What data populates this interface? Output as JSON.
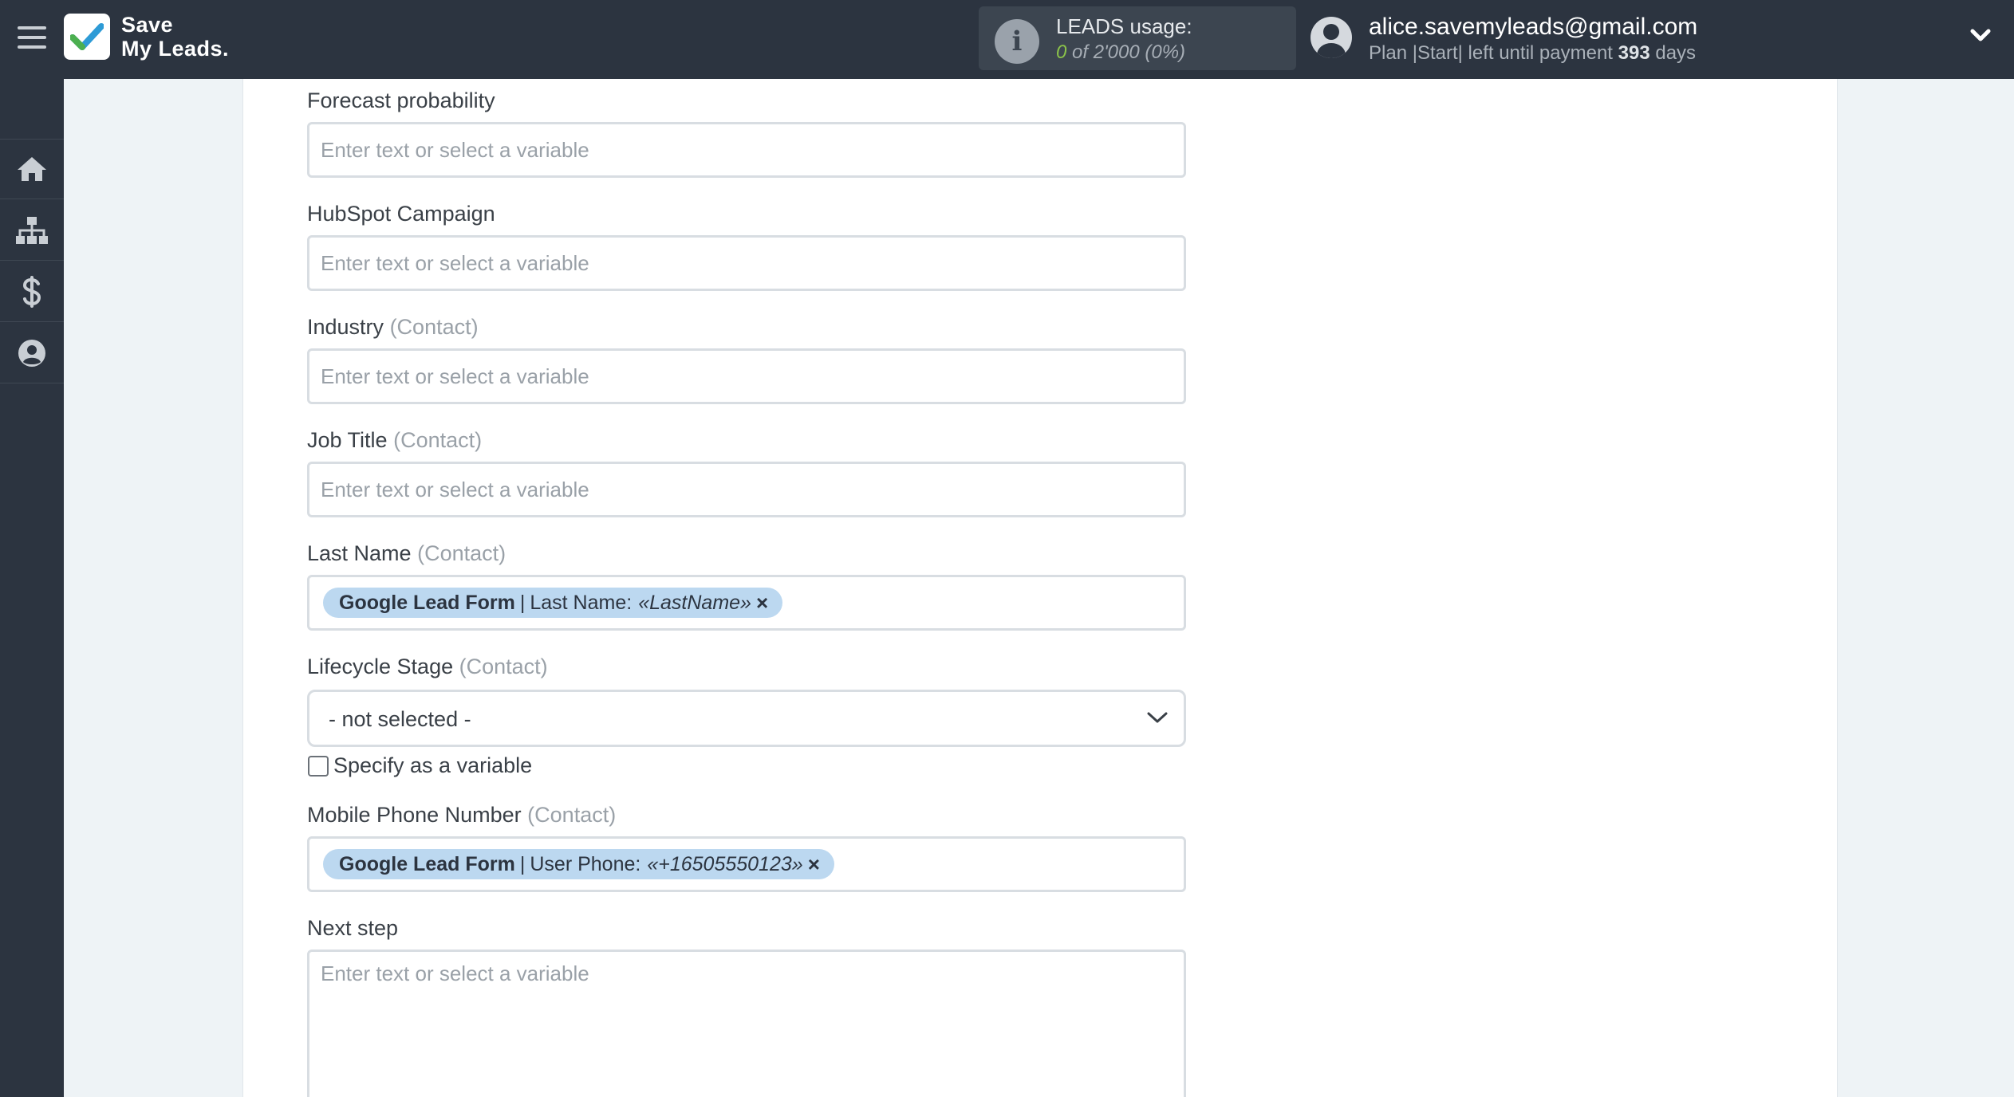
{
  "brand": {
    "line1": "Save",
    "line2": "My Leads."
  },
  "usage": {
    "title": "LEADS usage:",
    "count": "0",
    "of_total": "of 2'000",
    "percent": "(0%)"
  },
  "account": {
    "email": "alice.savemyleads@gmail.com",
    "plan_prefix": "Plan |Start| left until payment",
    "days": "393",
    "days_suffix": "days"
  },
  "sidebar": {
    "items": [
      {
        "icon": "home-icon"
      },
      {
        "icon": "sitemap-icon"
      },
      {
        "icon": "dollar-icon"
      },
      {
        "icon": "user-circle-icon"
      }
    ]
  },
  "form": {
    "placeholder": "Enter text or select a variable",
    "forecast": {
      "label": "Forecast probability"
    },
    "campaign": {
      "label": "HubSpot Campaign"
    },
    "industry": {
      "label": "Industry",
      "hint": "(Contact)"
    },
    "job_title": {
      "label": "Job Title",
      "hint": "(Contact)"
    },
    "last_name": {
      "label": "Last Name",
      "hint": "(Contact)",
      "tag": {
        "source": "Google Lead Form",
        "sep": "|",
        "field": "Last Name:",
        "value": "«LastName»",
        "remove": "×"
      }
    },
    "lifecycle": {
      "label": "Lifecycle Stage",
      "hint": "(Contact)",
      "selected": "- not selected -",
      "checkbox_label": "Specify as a variable"
    },
    "mobile": {
      "label": "Mobile Phone Number",
      "hint": "(Contact)",
      "tag": {
        "source": "Google Lead Form",
        "sep": "|",
        "field": "User Phone:",
        "value": "«+16505550123»",
        "remove": "×"
      }
    },
    "next_step": {
      "label": "Next step"
    }
  },
  "colors": {
    "topbar": "#2c3440",
    "accent_green": "#8bc34a",
    "tag_bg": "#bcd8f0",
    "page_bg": "#eef3f6"
  }
}
